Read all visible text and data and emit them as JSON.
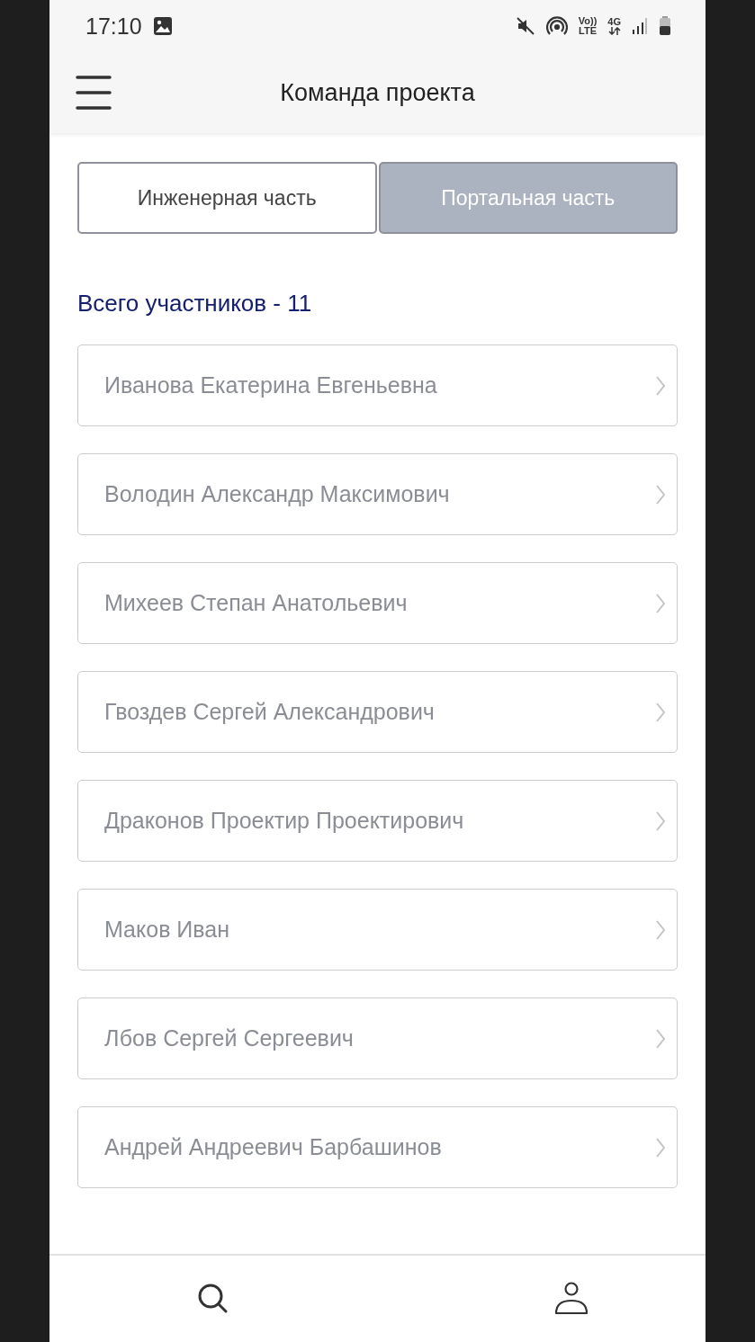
{
  "status_bar": {
    "time": "17:10",
    "volte_top": "Vo))",
    "volte_bottom": "LTE",
    "network": "4G"
  },
  "header": {
    "title": "Команда проекта"
  },
  "tabs": [
    {
      "label": "Инженерная часть",
      "selected": true
    },
    {
      "label": "Портальная часть",
      "selected": false
    }
  ],
  "members_count": "Всего участников - 11",
  "members": [
    {
      "name": "Иванова Екатерина Евгеньевна"
    },
    {
      "name": "Володин Александр Максимович"
    },
    {
      "name": "Михеев Степан Анатольевич"
    },
    {
      "name": "Гвоздев Сергей Александрович"
    },
    {
      "name": "Драконов Проектир Проектирович"
    },
    {
      "name": "Маков Иван"
    },
    {
      "name": "Лбов Сергей Сергеевич"
    },
    {
      "name": "Андрей Андреевич Барбашинов"
    }
  ]
}
